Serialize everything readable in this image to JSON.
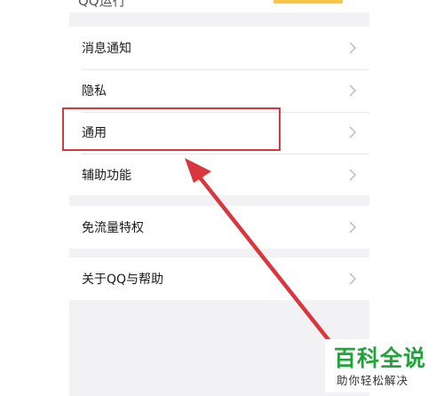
{
  "header": {
    "cut_text": "QQ运行",
    "badge_color": "#f6c54a"
  },
  "menu": {
    "group1": [
      {
        "label": "消息通知"
      },
      {
        "label": "隐私"
      },
      {
        "label": "通用"
      },
      {
        "label": "辅助功能"
      }
    ],
    "group2": [
      {
        "label": "免流量特权"
      }
    ],
    "group3": [
      {
        "label": "关于QQ与帮助"
      }
    ]
  },
  "annotation": {
    "highlight_color": "#d9363e",
    "arrow_color": "#d9363e",
    "target": "通用"
  },
  "brand": {
    "title": "百科全说",
    "subtitle": "助你轻松解决",
    "color": "#20a33a"
  }
}
